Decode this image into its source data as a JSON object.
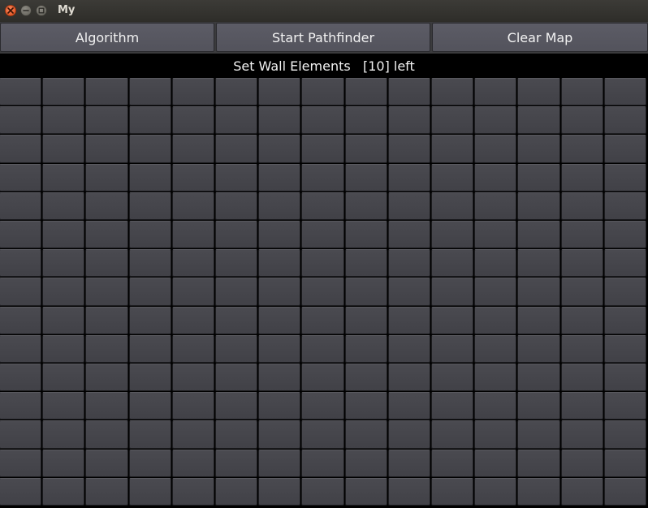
{
  "window": {
    "title": "My",
    "controls": {
      "close": "close-icon",
      "minimize": "minimize-icon",
      "maximize": "maximize-icon"
    }
  },
  "toolbar": {
    "algorithm_label": "Algorithm",
    "start_label": "Start Pathfinder",
    "clear_label": "Clear Map"
  },
  "status": {
    "text": "Set Wall Elements   [10] left"
  },
  "grid": {
    "rows": 15,
    "columns": 15
  },
  "colors": {
    "cell": "#444449",
    "button": "#57575f",
    "status_bar": "#000000",
    "close_button": "#e95420"
  }
}
